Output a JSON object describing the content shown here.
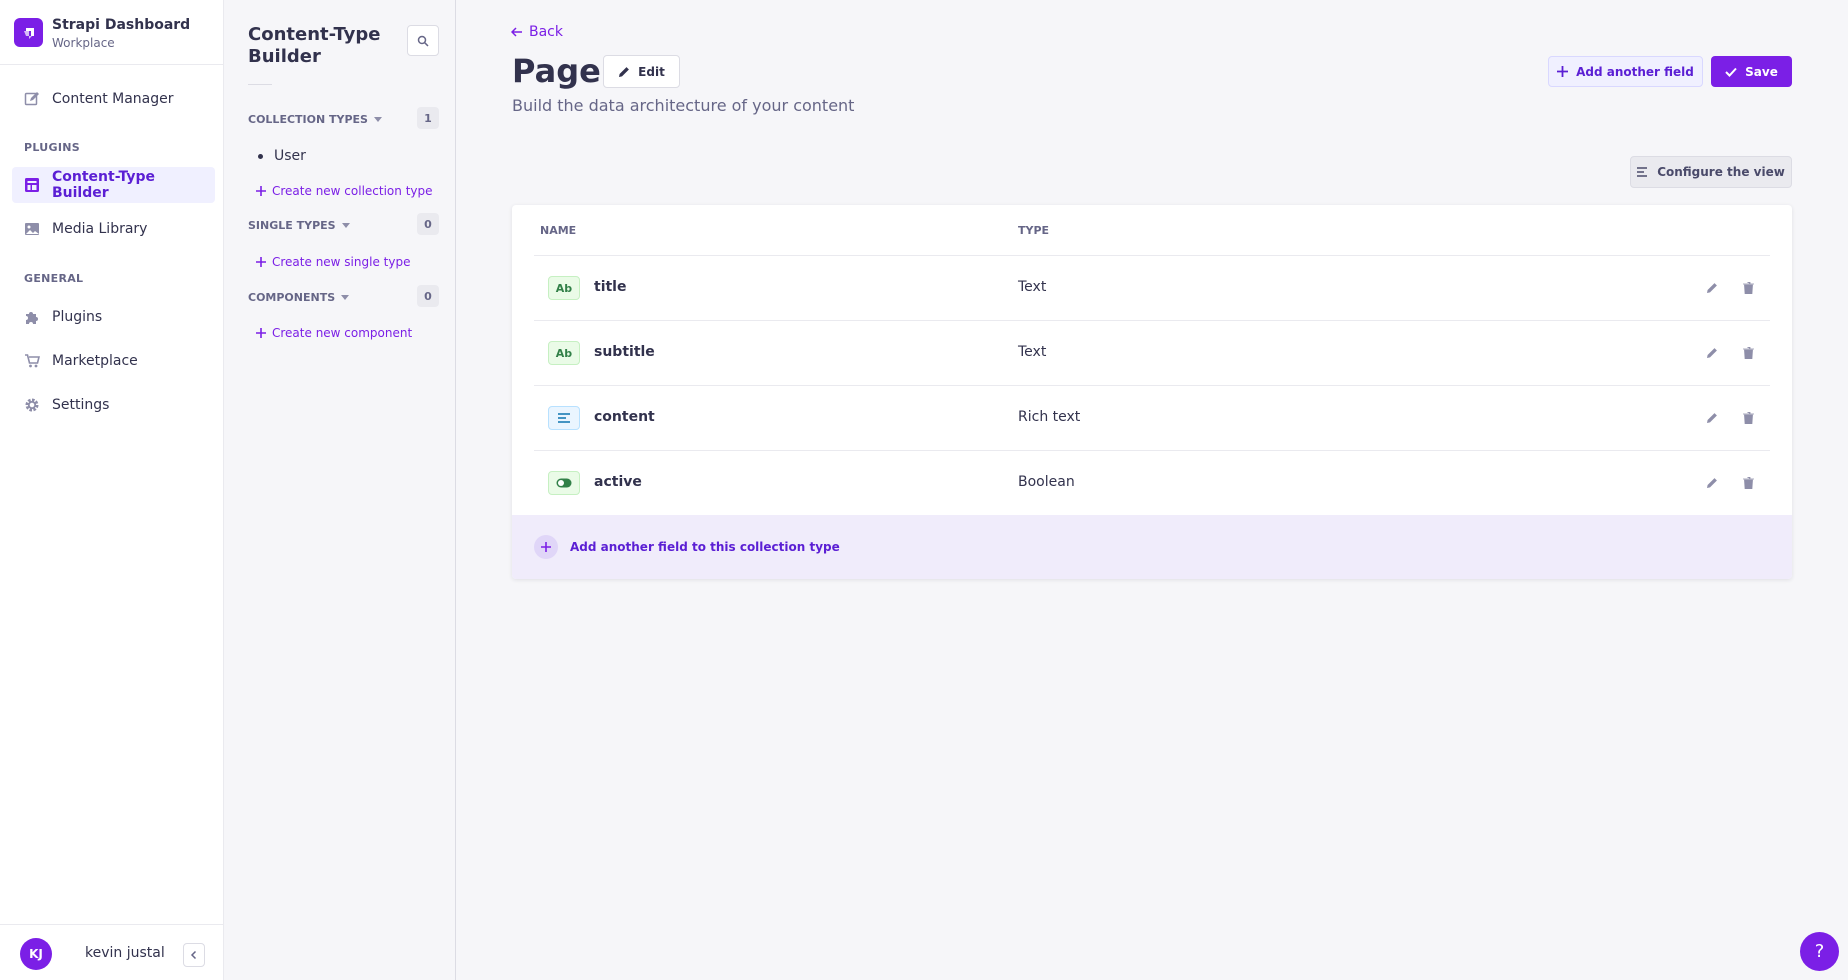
{
  "colors": {
    "accent": "#7b1fe6",
    "text": "#32324d",
    "muted": "#666687",
    "text_green": "#328048",
    "bg_green": "#eafbe7",
    "text_blue": "#0c75af",
    "bg_blue": "#eaf5ff"
  },
  "brand": {
    "title": "Strapi Dashboard",
    "subtitle": "Workplace"
  },
  "nav": {
    "content_manager": "Content Manager",
    "plugins_header": "PLUGINS",
    "content_type_builder": "Content-Type Builder",
    "media_library": "Media Library",
    "general_header": "GENERAL",
    "plugins": "Plugins",
    "marketplace": "Marketplace",
    "settings": "Settings"
  },
  "user": {
    "initials": "KJ",
    "name": "kevin justal"
  },
  "ctb": {
    "title": "Content-Type Builder",
    "collection_types": {
      "label": "COLLECTION TYPES",
      "count": "1",
      "items": [
        "User"
      ],
      "create": "Create new collection type"
    },
    "single_types": {
      "label": "SINGLE TYPES",
      "count": "0",
      "create": "Create new single type"
    },
    "components": {
      "label": "COMPONENTS",
      "count": "0",
      "create": "Create new component"
    }
  },
  "header": {
    "back": "Back",
    "title": "Page",
    "edit": "Edit",
    "subtitle": "Build the data architecture of your content",
    "add_field": "Add another field",
    "save": "Save",
    "configure": "Configure the view"
  },
  "table": {
    "col_name": "NAME",
    "col_type": "TYPE",
    "rows": [
      {
        "name": "title",
        "type": "Text",
        "icon": "text-icon",
        "icon_label": "Ab"
      },
      {
        "name": "subtitle",
        "type": "Text",
        "icon": "text-icon",
        "icon_label": "Ab"
      },
      {
        "name": "content",
        "type": "Rich text",
        "icon": "richtext-icon",
        "icon_label": ""
      },
      {
        "name": "active",
        "type": "Boolean",
        "icon": "boolean-icon",
        "icon_label": ""
      }
    ],
    "add_row": "Add another field to this collection type"
  },
  "help": "?"
}
